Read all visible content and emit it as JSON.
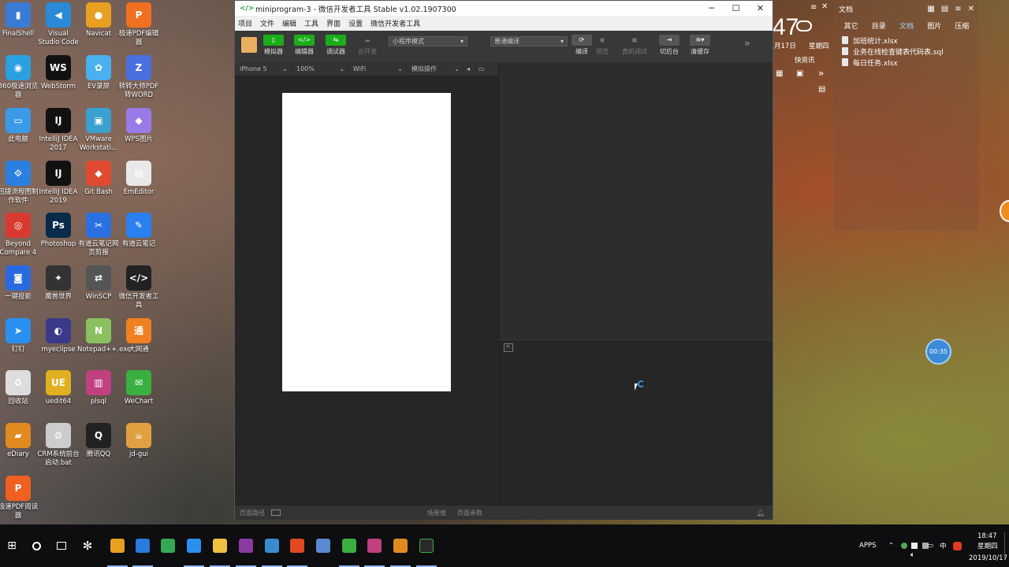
{
  "desktop": {
    "icons": [
      {
        "label": "FinalShell",
        "color": "#3a7bd5",
        "glyph": "▮"
      },
      {
        "label": "Visual Studio Code",
        "color": "#2a8ad8",
        "glyph": "◀"
      },
      {
        "label": "Navicat",
        "color": "#e8a020",
        "glyph": "●"
      },
      {
        "label": "极速PDF编辑器",
        "color": "#f07020",
        "glyph": "P"
      },
      {
        "label": "360极速浏览器",
        "color": "#2aa0e0",
        "glyph": "◉"
      },
      {
        "label": "WebStorm",
        "color": "#111",
        "glyph": "WS"
      },
      {
        "label": "EV录屏",
        "color": "#4ab0f0",
        "glyph": "✿"
      },
      {
        "label": "转转大师PDF转WORD",
        "color": "#4a70e0",
        "glyph": "Z"
      },
      {
        "label": "此电脑",
        "color": "#3a9ae8",
        "glyph": "▭"
      },
      {
        "label": "IntelliJ IDEA 2017",
        "color": "#111",
        "glyph": "IJ"
      },
      {
        "label": "VMware Workstati...",
        "color": "#3aa0d0",
        "glyph": "▣"
      },
      {
        "label": "WPS图片",
        "color": "#9a7ae8",
        "glyph": "◆"
      },
      {
        "label": "迅捷流程图制作软件",
        "color": "#2a80e0",
        "glyph": "⟐"
      },
      {
        "label": "IntelliJ IDEA 2019",
        "color": "#111",
        "glyph": "IJ"
      },
      {
        "label": "Git Bash",
        "color": "#e04a30",
        "glyph": "◆"
      },
      {
        "label": "EmEditor",
        "color": "#e8e8e8",
        "glyph": "▤"
      },
      {
        "label": "Beyond Compare 4",
        "color": "#d83a30",
        "glyph": "◎"
      },
      {
        "label": "Photoshop",
        "color": "#0a2a4a",
        "glyph": "Ps"
      },
      {
        "label": "有道云笔记网页剪报",
        "color": "#2a70e0",
        "glyph": "✂"
      },
      {
        "label": "有道云笔记",
        "color": "#2a80f0",
        "glyph": "✎"
      },
      {
        "label": "一键投影",
        "color": "#2a6ae0",
        "glyph": "◙"
      },
      {
        "label": "魔兽世界",
        "color": "#333",
        "glyph": "✦"
      },
      {
        "label": "WinSCP",
        "color": "#555",
        "glyph": "⇄"
      },
      {
        "label": "微信开发者工具",
        "color": "#222",
        "glyph": "</>"
      },
      {
        "label": "钉钉",
        "color": "#2a90f0",
        "glyph": "➤"
      },
      {
        "label": "myeclipse",
        "color": "#3a3a8a",
        "glyph": "◐"
      },
      {
        "label": "Notepad++.exe",
        "color": "#8ac060",
        "glyph": "N"
      },
      {
        "label": "大网通",
        "color": "#f08020",
        "glyph": "通"
      },
      {
        "label": "回收站",
        "color": "#ddd",
        "glyph": "♻"
      },
      {
        "label": "uedit64",
        "color": "#e0b020",
        "glyph": "UE"
      },
      {
        "label": "plsql",
        "color": "#c04080",
        "glyph": "▥"
      },
      {
        "label": "WeChart",
        "color": "#3ab040",
        "glyph": "✉"
      },
      {
        "label": "eDiary",
        "color": "#e08a20",
        "glyph": "▰"
      },
      {
        "label": "CRM系统前台启动.bat",
        "color": "#ccc",
        "glyph": "⚙"
      },
      {
        "label": "腾讯QQ",
        "color": "#222",
        "glyph": "Q"
      },
      {
        "label": "jd-gui",
        "color": "#e0a040",
        "glyph": "☕"
      },
      {
        "label": "极速PDF阅读器",
        "color": "#f06020",
        "glyph": "P"
      }
    ]
  },
  "clock_widget": {
    "time_fragment": "47",
    "date": "月17日",
    "weekday": "星期四",
    "quick_label": "快资讯"
  },
  "file_widget": {
    "title": "文档",
    "tabs": [
      "其它",
      "目录",
      "文档",
      "图片",
      "压缩"
    ],
    "active_tab": "文档",
    "files": [
      "加班统计.xlsx",
      "业务在线检查键表代码表.sql",
      "每日任务.xlsx"
    ]
  },
  "devtools": {
    "title": "miniprogram-3 - 微信开发者工具 Stable v1.02.1907300",
    "menu": [
      "项目",
      "文件",
      "编辑",
      "工具",
      "界面",
      "设置",
      "微信开发者工具"
    ],
    "toolbar": {
      "simulator": "模拟器",
      "editor": "编辑器",
      "debugger": "调试器",
      "cloud": "云开发",
      "mode_select": "小程序模式",
      "compile_select": "普通编译",
      "compile": "编译",
      "preview": "预览",
      "remote_debug": "真机调试",
      "background": "切后台",
      "clear_cache": "清缓存",
      "more": "»"
    },
    "subbar": {
      "device": "iPhone 5",
      "zoom": "100%",
      "network": "WiFi",
      "operation": "模拟操作"
    },
    "status": {
      "page_path": "页面路径",
      "scene": "场景值",
      "page_params": "页面参数"
    }
  },
  "float_timer": "00:35",
  "taskbar": {
    "tray_apps": "APPS",
    "ime": "中",
    "time": "18:47",
    "weekday": "星期四",
    "date": "2019/10/17"
  }
}
